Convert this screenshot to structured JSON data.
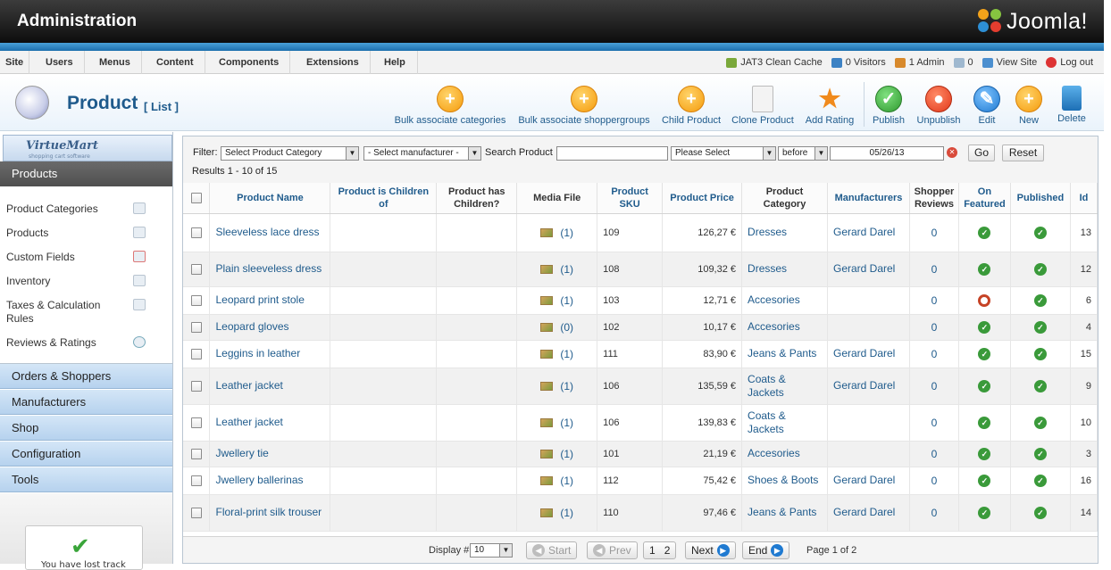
{
  "header": {
    "title": "Administration",
    "logo_text": "Joomla!"
  },
  "menu": [
    "Site",
    "Users",
    "Menus",
    "Content",
    "Components",
    "Extensions",
    "Help"
  ],
  "status": {
    "cache": "JAT3 Clean Cache",
    "visitors": "0 Visitors",
    "admin": "1 Admin",
    "messages": "0",
    "view_site": "View Site",
    "logout": "Log out"
  },
  "page": {
    "title": "Product",
    "subtitle": "[ List ]"
  },
  "toolbar": {
    "bulk_categories": "Bulk associate categories",
    "bulk_shoppergroups": "Bulk associate shoppergroups",
    "child_product": "Child Product",
    "clone_product": "Clone Product",
    "add_rating": "Add Rating",
    "publish": "Publish",
    "unpublish": "Unpublish",
    "edit": "Edit",
    "new": "New",
    "delete": "Delete"
  },
  "sidebar": {
    "logo": "VirtueMart",
    "logo_sub": "shopping cart software",
    "active_section": "Products",
    "items": [
      "Product Categories",
      "Products",
      "Custom Fields",
      "Inventory",
      "Taxes & Calculation Rules",
      "Reviews & Ratings"
    ],
    "sections": [
      "Orders & Shoppers",
      "Manufacturers",
      "Shop",
      "Configuration",
      "Tools"
    ],
    "message": "You have lost track"
  },
  "filter": {
    "label": "Filter:",
    "category": "Select Product Category",
    "manufacturer": "- Select manufacturer -",
    "search_label": "Search Product",
    "search_value": "",
    "date_option": "Please Select",
    "date_relation": "before",
    "date": "05/26/13",
    "go": "Go",
    "reset": "Reset",
    "results": "Results 1 - 10 of 15"
  },
  "table": {
    "headers": {
      "name": "Product Name",
      "children_of": "Product is Children of",
      "has_children": "Product has Children?",
      "media": "Media File",
      "sku": "Product SKU",
      "price": "Product Price",
      "category": "Product Category",
      "manufacturers": "Manufacturers",
      "reviews": "Shopper Reviews",
      "featured": "On Featured",
      "published": "Published",
      "id": "Id"
    },
    "rows": [
      {
        "name": "Sleeveless lace dress",
        "media": "(1)",
        "sku": "109",
        "price": "126,27 €",
        "category": "Dresses",
        "manufacturer": "Gerard Darel",
        "reviews": "0",
        "featured": true,
        "published": true,
        "id": "13"
      },
      {
        "name": "Plain sleeveless dress",
        "media": "(1)",
        "sku": "108",
        "price": "109,32 €",
        "category": "Dresses",
        "manufacturer": "Gerard Darel",
        "reviews": "0",
        "featured": true,
        "published": true,
        "id": "12"
      },
      {
        "name": "Leopard print stole",
        "media": "(1)",
        "sku": "103",
        "price": "12,71 €",
        "category": "Accesories",
        "manufacturer": "",
        "reviews": "0",
        "featured": false,
        "published": true,
        "id": "6"
      },
      {
        "name": "Leopard gloves",
        "media": "(0)",
        "sku": "102",
        "price": "10,17 €",
        "category": "Accesories",
        "manufacturer": "",
        "reviews": "0",
        "featured": true,
        "published": true,
        "id": "4"
      },
      {
        "name": "Leggins in leather",
        "media": "(1)",
        "sku": "111",
        "price": "83,90 €",
        "category": "Jeans & Pants",
        "manufacturer": "Gerard Darel",
        "reviews": "0",
        "featured": true,
        "published": true,
        "id": "15"
      },
      {
        "name": "Leather jacket",
        "media": "(1)",
        "sku": "106",
        "price": "135,59 €",
        "category": "Coats & Jackets",
        "manufacturer": "Gerard Darel",
        "reviews": "0",
        "featured": true,
        "published": true,
        "id": "9"
      },
      {
        "name": "Leather jacket",
        "media": "(1)",
        "sku": "106",
        "price": "139,83 €",
        "category": "Coats & Jackets",
        "manufacturer": "",
        "reviews": "0",
        "featured": true,
        "published": true,
        "id": "10"
      },
      {
        "name": "Jwellery tie",
        "media": "(1)",
        "sku": "101",
        "price": "21,19 €",
        "category": "Accesories",
        "manufacturer": "",
        "reviews": "0",
        "featured": true,
        "published": true,
        "id": "3"
      },
      {
        "name": "Jwellery ballerinas",
        "media": "(1)",
        "sku": "112",
        "price": "75,42 €",
        "category": "Shoes & Boots",
        "manufacturer": "Gerard Darel",
        "reviews": "0",
        "featured": true,
        "published": true,
        "id": "16"
      },
      {
        "name": "Floral-print silk trouser",
        "media": "(1)",
        "sku": "110",
        "price": "97,46 €",
        "category": "Jeans & Pants",
        "manufacturer": "Gerard Darel",
        "reviews": "0",
        "featured": true,
        "published": true,
        "id": "14"
      }
    ]
  },
  "pager": {
    "display_label": "Display #",
    "display_value": "10",
    "start": "Start",
    "prev": "Prev",
    "page1": "1",
    "page2": "2",
    "next": "Next",
    "end": "End",
    "page_of": "Page 1 of 2"
  }
}
